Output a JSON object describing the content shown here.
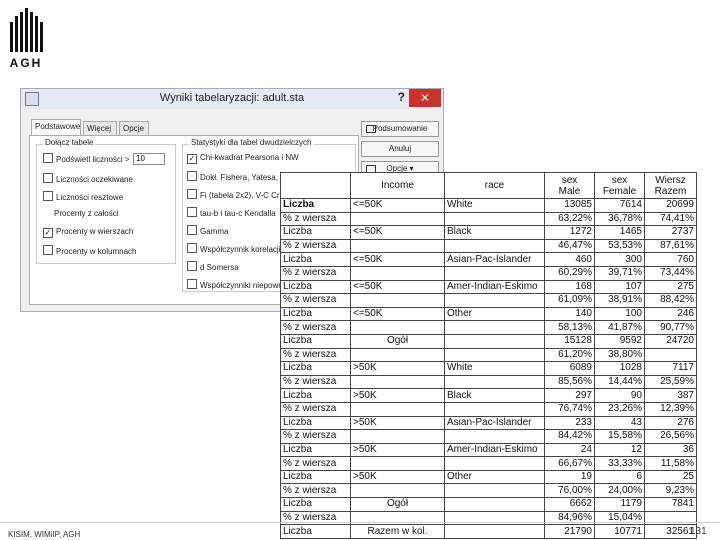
{
  "logo": {
    "text": "AGH"
  },
  "dialog": {
    "title": "Wyniki tabelaryzacji: adult.sta",
    "help": "?",
    "close": "✕",
    "tabs": [
      "Podstawowe",
      "Więcej",
      "Opcje"
    ],
    "group_left": {
      "title": "Dołącz tabele",
      "options": [
        {
          "label": "Podświetl liczności >",
          "checked": false,
          "value": "10"
        },
        {
          "label": "Liczności oczekiwane",
          "checked": false
        },
        {
          "label": "Liczności resztowe",
          "checked": false
        },
        {
          "label": "Procenty z całości",
          "checked": false
        },
        {
          "label": "Procenty w wierszach",
          "checked": true
        },
        {
          "label": "Procenty w kolumnach",
          "checked": false
        }
      ]
    },
    "group_right": {
      "title": "Statystyki dla tabel dwudzielczych",
      "options": [
        {
          "label": "Chi-kwadrat Pearsona i NW",
          "checked": true
        },
        {
          "label": "Dokł. Fishera, Yatesa, M",
          "checked": false
        },
        {
          "label": "Fi (tabela 2x2), V-C Cra",
          "checked": false
        },
        {
          "label": "tau-b i tau-c Kendalla",
          "checked": false
        },
        {
          "label": "Gamma",
          "checked": false
        },
        {
          "label": "Współczynnik korelacji",
          "checked": false
        },
        {
          "label": "d Somersa",
          "checked": false
        },
        {
          "label": "Współczynniki niepown",
          "checked": false
        }
      ]
    },
    "buttons": {
      "summary": "Podsumowanie",
      "cancel": "Anuluj",
      "options": "Opcje"
    }
  },
  "table": {
    "header": [
      "Income",
      "race",
      "sex\nMale",
      "sex\nFemale",
      "Wiersz\nRazem"
    ],
    "rows": [
      [
        "Liczba",
        "<=50K",
        "White",
        "13085",
        "7614",
        "20699"
      ],
      [
        "% z wiersza",
        "",
        "",
        "63,22%",
        "36,78%",
        "74,41%"
      ],
      [
        "Liczba",
        "<=50K",
        "Black",
        "1272",
        "1465",
        "2737"
      ],
      [
        "% z wiersza",
        "",
        "",
        "46,47%",
        "53,53%",
        "87,61%"
      ],
      [
        "Liczba",
        "<=50K",
        "Asian-Pac-Islander",
        "460",
        "300",
        "760"
      ],
      [
        "% z wiersza",
        "",
        "",
        "60,29%",
        "39,71%",
        "73,44%"
      ],
      [
        "Liczba",
        "<=50K",
        "Amer-Indian-Eskimo",
        "168",
        "107",
        "275"
      ],
      [
        "% z wiersza",
        "",
        "",
        "61,09%",
        "38,91%",
        "88,42%"
      ],
      [
        "Liczba",
        "<=50K",
        "Other",
        "140",
        "100",
        "246"
      ],
      [
        "% z wiersza",
        "",
        "",
        "58,13%",
        "41,87%",
        "90,77%"
      ],
      [
        "Liczba",
        "Ogół",
        "",
        "15128",
        "9592",
        "24720"
      ],
      [
        "% z wiersza",
        "",
        "",
        "61,20%",
        "38,80%",
        ""
      ],
      [
        "Liczba",
        ">50K",
        "White",
        "6089",
        "1028",
        "7117"
      ],
      [
        "% z wiersza",
        "",
        "",
        "85,56%",
        "14,44%",
        "25,59%"
      ],
      [
        "Liczba",
        ">50K",
        "Black",
        "297",
        "90",
        "387"
      ],
      [
        "% z wiersza",
        "",
        "",
        "76,74%",
        "23,26%",
        "12,39%"
      ],
      [
        "Liczba",
        ">50K",
        "Asian-Pac-Islander",
        "233",
        "43",
        "276"
      ],
      [
        "% z wiersza",
        "",
        "",
        "84,42%",
        "15,58%",
        "26,56%"
      ],
      [
        "Liczba",
        ">50K",
        "Amer-Indian-Eskimo",
        "24",
        "12",
        "36"
      ],
      [
        "% z wiersza",
        "",
        "",
        "66,67%",
        "33,33%",
        "11,58%"
      ],
      [
        "Liczba",
        ">50K",
        "Other",
        "19",
        "6",
        "25"
      ],
      [
        "% z wiersza",
        "",
        "",
        "76,00%",
        "24,00%",
        "9,23%"
      ],
      [
        "Liczba",
        "Ogół",
        "",
        "6662",
        "1179",
        "7841"
      ],
      [
        "% z wiersza",
        "",
        "",
        "84,96%",
        "15,04%",
        ""
      ],
      [
        "Liczba",
        "Razem w kol.",
        "",
        "21790",
        "10771",
        "32561"
      ]
    ]
  },
  "footer": {
    "left": "KISIM, WIMiIP, AGH",
    "page": "131"
  }
}
